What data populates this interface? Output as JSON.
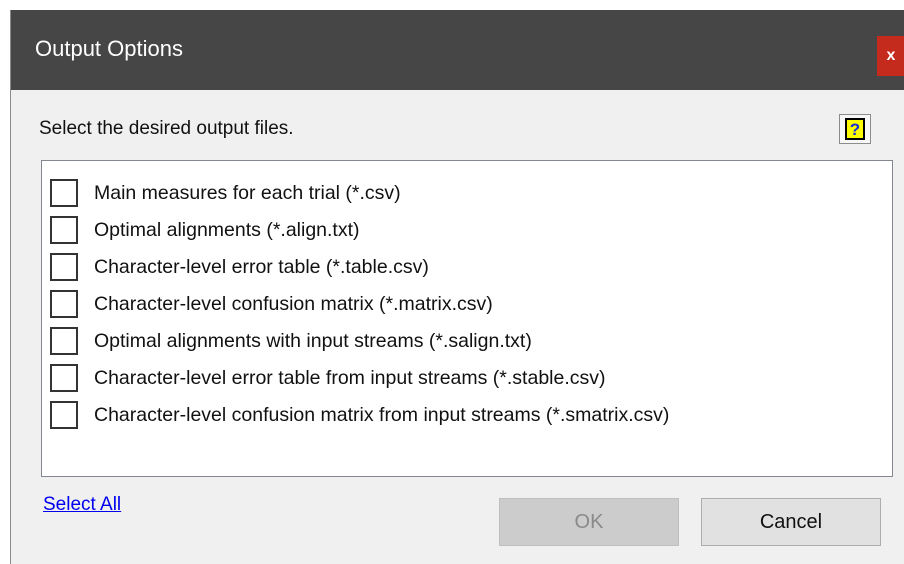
{
  "window": {
    "title": "Output Options",
    "close_label": "x"
  },
  "prompt": "Select the desired output files.",
  "help": {
    "glyph": "?"
  },
  "options": [
    {
      "label": "Main measures for each trial (*.csv)",
      "checked": false
    },
    {
      "label": "Optimal alignments (*.align.txt)",
      "checked": false
    },
    {
      "label": "Character-level error table (*.table.csv)",
      "checked": false
    },
    {
      "label": "Character-level confusion matrix (*.matrix.csv)",
      "checked": false
    },
    {
      "label": "Optimal alignments with input streams (*.salign.txt)",
      "checked": false
    },
    {
      "label": "Character-level error table from input streams (*.stable.csv)",
      "checked": false
    },
    {
      "label": "Character-level confusion matrix from input streams (*.smatrix.csv)",
      "checked": false
    }
  ],
  "select_all": "Select All",
  "buttons": {
    "ok": "OK",
    "ok_enabled": false,
    "cancel": "Cancel"
  }
}
